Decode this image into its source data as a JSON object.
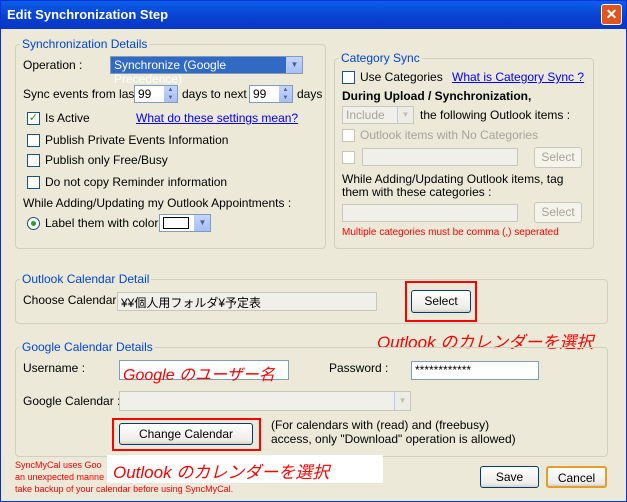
{
  "window": {
    "title": "Edit Synchronization Step",
    "close_glyph": "✕"
  },
  "sync_details": {
    "legend": "Synchronization Details",
    "operation_label": "Operation :",
    "operation_value": "Synchronize (Google Precedence)",
    "sync_events_label": "Sync events from last",
    "days_back": "99",
    "days_to_next_label": "days to next",
    "days_forward": "99",
    "days_label": "days",
    "is_active_label": "Is Active",
    "is_active_checked": "✓",
    "settings_link": "What do these settings mean?",
    "publish_private_label": "Publish Private Events Information",
    "publish_free_busy_label": "Publish only Free/Busy",
    "no_reminder_label": "Do not copy Reminder information",
    "while_adding_label": "While Adding/Updating my Outlook Appointments :",
    "label_color_label": "Label them with color"
  },
  "category_sync": {
    "legend": "Category Sync",
    "use_categories_label": "Use Categories",
    "category_link": "What is Category Sync ?",
    "during_upload_label": "During Upload / Synchronization,",
    "include_value": "Include",
    "following_items_label": "the following Outlook items :",
    "no_categories_label": "Outlook items with No Categories",
    "select_label": "Select",
    "tag_label_line1": "While Adding/Updating Outlook items, tag",
    "tag_label_line2": "them with these categories :",
    "select2_label": "Select",
    "note": "Multiple categories must be comma (,) seperated"
  },
  "outlook_detail": {
    "legend": "Outlook Calendar Detail",
    "choose_label": "Choose Calendar :",
    "calendar_path": "¥¥個人用フォルダ¥予定表",
    "select_label": "Select",
    "annotation": "Outlook のカレンダーを選択"
  },
  "google_details": {
    "legend": "Google Calendar Details",
    "username_label": "Username :",
    "username_annotation": "Google のユーザー名",
    "password_label": "Password :",
    "password_value": "************",
    "calendar_label": "Google Calendar :",
    "change_button": "Change Calendar",
    "note_line1": "(For calendars with (read) and (freebusy)",
    "note_line2": "access, only \"Download\" operation is allowed)"
  },
  "footer": {
    "warning_line1": "SyncMyCal uses Goo",
    "warning_line2": "an unexpected manne",
    "warning_line3": "take backup of your calendar before using SyncMyCal.",
    "annotation": "Outlook のカレンダーを選択",
    "save_label": "Save",
    "cancel_label": "Cancel"
  },
  "colors": {
    "legend_blue": "#0046d5",
    "annotation_red": "#ff0000",
    "title_blue": "#0a3fd0"
  }
}
